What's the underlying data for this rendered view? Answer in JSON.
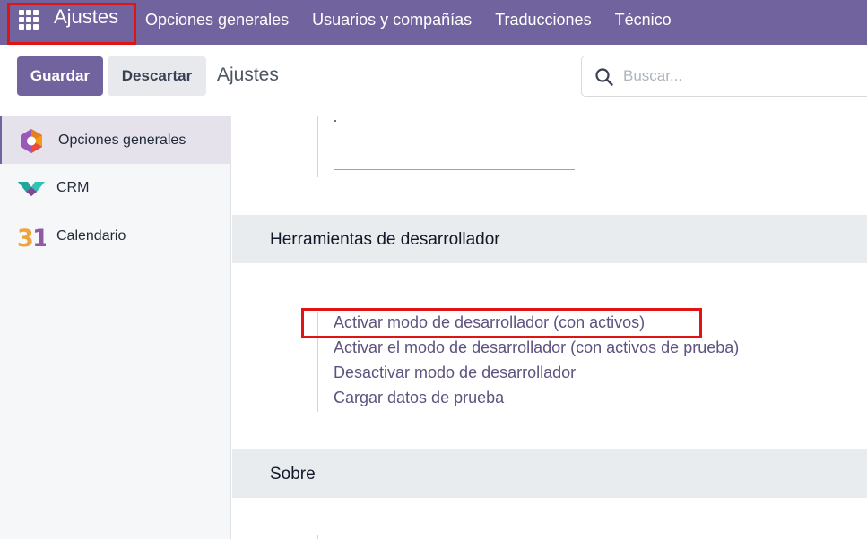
{
  "navbar": {
    "brand": "Ajustes",
    "menu": [
      "Opciones generales",
      "Usuarios y compañías",
      "Traducciones",
      "Técnico"
    ]
  },
  "control_panel": {
    "save_label": "Guardar",
    "discard_label": "Descartar",
    "title": "Ajustes",
    "search_placeholder": "Buscar..."
  },
  "sidebar": {
    "items": [
      {
        "label": "Opciones generales",
        "icon": "general-settings-icon",
        "active": true
      },
      {
        "label": "CRM",
        "icon": "crm-icon",
        "active": false
      },
      {
        "label": "Calendario",
        "icon": "calendar-icon",
        "active": false
      }
    ]
  },
  "sections": {
    "developer": {
      "title": "Herramientas de desarrollador",
      "links": [
        "Activar modo de desarrollador (con activos)",
        "Activar el modo de desarrollador (con activos de prueba)",
        "Desactivar modo de desarrollador",
        "Cargar datos de prueba"
      ]
    },
    "about": {
      "title": "Sobre"
    }
  },
  "colors": {
    "primary": "#71639e",
    "link": "#5e527f",
    "highlight": "#e01414",
    "section_bg": "#e9ecef"
  }
}
